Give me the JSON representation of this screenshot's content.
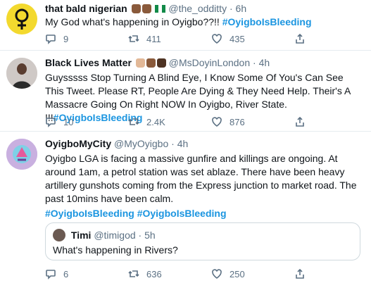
{
  "tweets": [
    {
      "name": "that bald nigerian",
      "handle": "@the_odditty",
      "time": "6h",
      "text": "My God what's happening in Oyigbo??!!",
      "hashtag": "#OyigboIsBleeding",
      "replies": "9",
      "retweets": "411",
      "likes": "435"
    },
    {
      "name": "Black Lives Matter",
      "handle": "@MsDoyinLondon",
      "time": "4h",
      "text": "Guysssss Stop Turning A Blind Eye, I Know Some Of You's Can See This Tweet. Please RT, People Are Dying & They Need Help. Their's A Massacre Going On Right NOW In Oyigbo, River State. !!!",
      "hashtag": "#OyigboIsBleeding",
      "replies": "10",
      "retweets": "2.4K",
      "likes": "876"
    },
    {
      "name": "OyigboMyCity",
      "handle": "@MyOyigbo",
      "time": "4h",
      "text": "Oyigbo LGA is facing a massive gunfire and killings are ongoing. At around 1am, a petrol station was set ablaze. There have been heavy artillery gunshots coming from the Express junction to market road. The past 10mins have been calm.",
      "hashtag": "#OyigboIsBleeding",
      "hashtag2": "#OyigboIsBleeding",
      "quote": {
        "name": "Timi",
        "handle": "@timigod",
        "time": "5h",
        "text": "What's happening in Rivers?"
      },
      "replies": "6",
      "retweets": "636",
      "likes": "250"
    }
  ],
  "separator": "·",
  "colors": {
    "accent": "#1b95e0",
    "muted": "#5b7083",
    "border": "#e6ecf0"
  },
  "icons": [
    "reply-icon",
    "retweet-icon",
    "like-icon",
    "share-icon"
  ]
}
